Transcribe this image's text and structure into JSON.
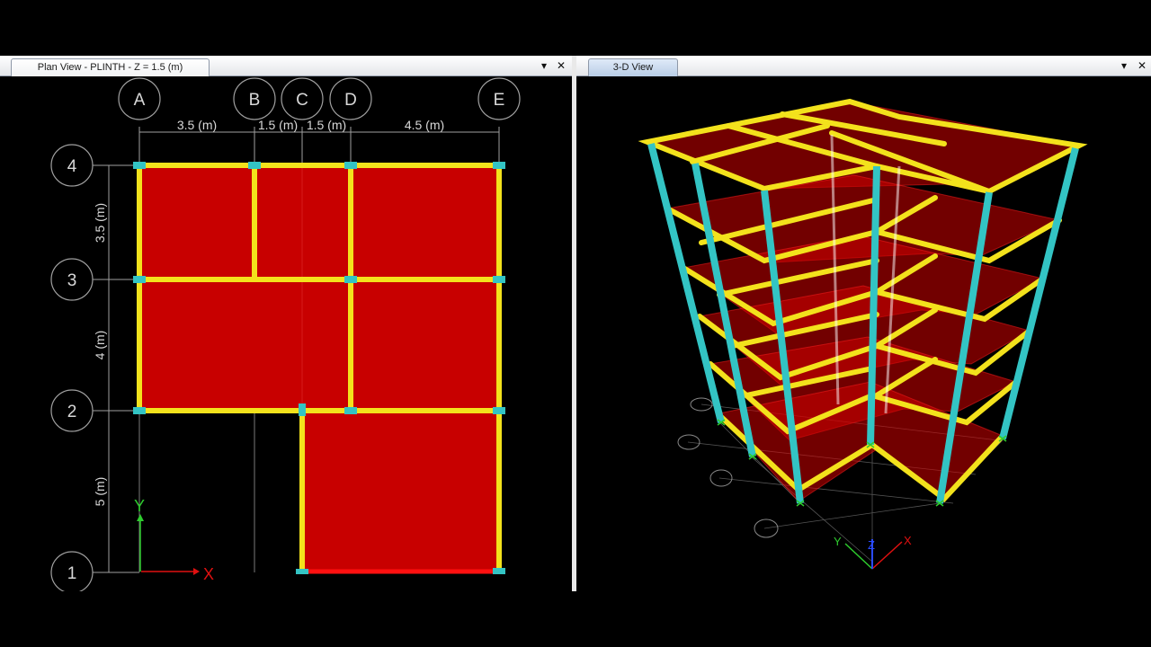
{
  "colors": {
    "slab": "#c80000",
    "beam": "#f3e21c",
    "column": "#33c4c4",
    "grid": "#9a9a9a",
    "axis_x": "#e01010",
    "axis_y": "#2ecc2e",
    "axis_z": "#2a4bff",
    "background": "#000000"
  },
  "left_window": {
    "tab_title": "Plan View - PLINTH - Z = 1.5 (m)",
    "dropdown_icon": "caret-down-icon",
    "close_icon": "close-icon",
    "dropdown_glyph": "▾",
    "close_glyph": "✕",
    "grid_x_labels": [
      "A",
      "B",
      "C",
      "D",
      "E"
    ],
    "grid_y_labels": [
      "4",
      "3",
      "2",
      "1"
    ],
    "x_dimensions": [
      "3.5 (m)",
      "1.5 (m)",
      "1.5 (m)",
      "4.5 (m)"
    ],
    "y_dimensions": [
      "3.5 (m)",
      "4 (m)",
      "5 (m)"
    ],
    "axis_labels": {
      "x": "X",
      "y": "Y"
    }
  },
  "right_window": {
    "tab_title": "3-D View",
    "dropdown_glyph": "▾",
    "close_glyph": "✕",
    "axis_labels": {
      "x": "X",
      "y": "Y",
      "z": "Z"
    }
  }
}
